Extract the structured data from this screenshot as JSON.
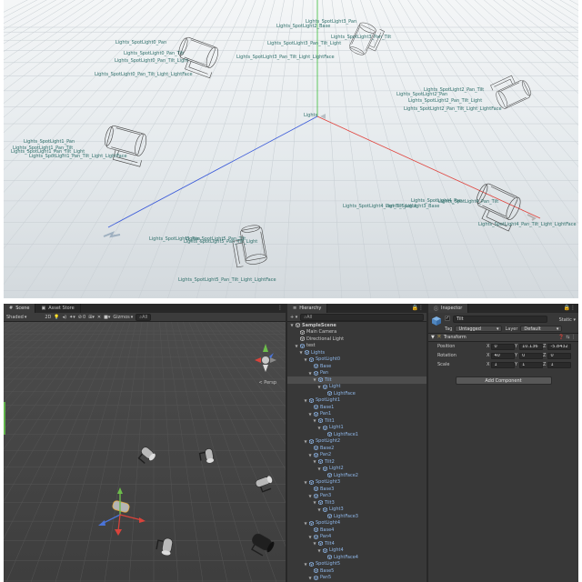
{
  "top_view": {
    "labels": [
      "Lights_SpotLight0_Pan",
      "Lights_SpotLight0_Pan_Tilt",
      "Lights_SpotLight0_Pan_Tilt_Light",
      "Lights_SpotLight0_Pan_Tilt_Light_LightFace",
      "Lights_SpotLight1_Pan",
      "Lights_SpotLight1_Pan_Tilt",
      "Lights_SpotLight1_Pan_Tilt_Light",
      "Lights_SpotLight1_Pan_Tilt_Light_LightFace",
      "Lights_SpotLight2_Pan",
      "Lights_SpotLight2_Pan_Tilt",
      "Lights_SpotLight2_Pan_Tilt_Light",
      "Lights_SpotLight2_Pan_Tilt_Light_LightFace",
      "Lights_SpotLight3_Pan",
      "Lights_SpotLight3_Pan_Tilt",
      "Lights_SpotLight3_Pan_Tilt_Light",
      "Lights_SpotLight3_Pan_Tilt_Light_LightFace",
      "Lights_SpotLight4_Pan",
      "Lights_SpotLight4_Pan_Tilt",
      "Lights_SpotLight4_Pan_Tilt_Light",
      "Lights_SpotLight4_Pan_Tilt_Light_LightFace",
      "Lights_SpotLight5_Pan",
      "Lights_SpotLight5_Pan_Tilt",
      "Lights_SpotLight5_Pan_Tilt_Light",
      "Lights_SpotLight5_Pan_Tilt_Light_LightFace",
      "Lights",
      "Lights_SpotLight3_Base",
      "Lights_SpotLight2_Base"
    ],
    "axis_colors": {
      "x": "#e0403a",
      "y": "#3bbd3b",
      "z": "#3b5bd9"
    }
  },
  "scene_panel": {
    "tabs": [
      "Scene",
      "Asset Store"
    ],
    "more_glyph": "⋮",
    "toolbar": {
      "shading": "Shaded",
      "mode_2d": "2D",
      "gizmos": "Gizmos",
      "search_placeholder": "All",
      "count_badge": "0"
    },
    "persp_label": "< Persp"
  },
  "hierarchy": {
    "tab": "Hierarchy",
    "add_label": "+ ▾",
    "search_placeholder": "All",
    "tree": [
      {
        "label": "SampleScene",
        "depth": 0,
        "arrow": "▼",
        "kind": "scene"
      },
      {
        "label": "Main Camera",
        "depth": 1,
        "arrow": "",
        "kind": "obj"
      },
      {
        "label": "Directional Light",
        "depth": 1,
        "arrow": "",
        "kind": "obj"
      },
      {
        "label": "test",
        "depth": 1,
        "arrow": "▼",
        "kind": "prefab"
      },
      {
        "label": "Lights",
        "depth": 2,
        "arrow": "▼",
        "kind": "blue"
      },
      {
        "label": "SpotLight0",
        "depth": 3,
        "arrow": "▼",
        "kind": "blue"
      },
      {
        "label": "Base",
        "depth": 4,
        "arrow": "",
        "kind": "blue"
      },
      {
        "label": "Pan",
        "depth": 4,
        "arrow": "▼",
        "kind": "blue"
      },
      {
        "label": "Tilt",
        "depth": 5,
        "arrow": "▼",
        "kind": "blue",
        "selected": true
      },
      {
        "label": "Light",
        "depth": 6,
        "arrow": "▼",
        "kind": "blue"
      },
      {
        "label": "LightFace",
        "depth": 7,
        "arrow": "",
        "kind": "blue"
      },
      {
        "label": "SpotLight1",
        "depth": 3,
        "arrow": "▼",
        "kind": "blue"
      },
      {
        "label": "Base1",
        "depth": 4,
        "arrow": "",
        "kind": "blue"
      },
      {
        "label": "Pan1",
        "depth": 4,
        "arrow": "▼",
        "kind": "blue"
      },
      {
        "label": "Tilt1",
        "depth": 5,
        "arrow": "▼",
        "kind": "blue"
      },
      {
        "label": "Light1",
        "depth": 6,
        "arrow": "▼",
        "kind": "blue"
      },
      {
        "label": "LightFace1",
        "depth": 7,
        "arrow": "",
        "kind": "blue"
      },
      {
        "label": "SpotLight2",
        "depth": 3,
        "arrow": "▼",
        "kind": "blue"
      },
      {
        "label": "Base2",
        "depth": 4,
        "arrow": "",
        "kind": "blue"
      },
      {
        "label": "Pan2",
        "depth": 4,
        "arrow": "▼",
        "kind": "blue"
      },
      {
        "label": "Tilt2",
        "depth": 5,
        "arrow": "▼",
        "kind": "blue"
      },
      {
        "label": "Light2",
        "depth": 6,
        "arrow": "▼",
        "kind": "blue"
      },
      {
        "label": "LightFace2",
        "depth": 7,
        "arrow": "",
        "kind": "blue"
      },
      {
        "label": "SpotLight3",
        "depth": 3,
        "arrow": "▼",
        "kind": "blue"
      },
      {
        "label": "Base3",
        "depth": 4,
        "arrow": "",
        "kind": "blue"
      },
      {
        "label": "Pan3",
        "depth": 4,
        "arrow": "▼",
        "kind": "blue"
      },
      {
        "label": "Tilt3",
        "depth": 5,
        "arrow": "▼",
        "kind": "blue"
      },
      {
        "label": "Light3",
        "depth": 6,
        "arrow": "▼",
        "kind": "blue"
      },
      {
        "label": "LightFace3",
        "depth": 7,
        "arrow": "",
        "kind": "blue"
      },
      {
        "label": "SpotLight4",
        "depth": 3,
        "arrow": "▼",
        "kind": "blue"
      },
      {
        "label": "Base4",
        "depth": 4,
        "arrow": "",
        "kind": "blue"
      },
      {
        "label": "Pan4",
        "depth": 4,
        "arrow": "▼",
        "kind": "blue"
      },
      {
        "label": "Tilt4",
        "depth": 5,
        "arrow": "▼",
        "kind": "blue"
      },
      {
        "label": "Light4",
        "depth": 6,
        "arrow": "▼",
        "kind": "blue"
      },
      {
        "label": "LightFace4",
        "depth": 7,
        "arrow": "",
        "kind": "blue"
      },
      {
        "label": "SpotLight5",
        "depth": 3,
        "arrow": "▼",
        "kind": "blue"
      },
      {
        "label": "Base5",
        "depth": 4,
        "arrow": "",
        "kind": "blue"
      },
      {
        "label": "Pan5",
        "depth": 4,
        "arrow": "▼",
        "kind": "blue"
      },
      {
        "label": "Tilt5",
        "depth": 5,
        "arrow": "▼",
        "kind": "blue"
      }
    ]
  },
  "inspector": {
    "tab": "Inspector",
    "object_name": "Tilt",
    "static_label": "Static ▾",
    "tag_label": "Tag",
    "tag_value": "Untagged",
    "layer_label": "Layer",
    "layer_value": "Default",
    "transform": {
      "title": "Transform",
      "rows": [
        {
          "name": "Position",
          "x": "0",
          "y": "10.136",
          "z": "-5.8432"
        },
        {
          "name": "Rotation",
          "x": "40",
          "y": "0",
          "z": "0"
        },
        {
          "name": "Scale",
          "x": "1",
          "y": "1",
          "z": "1"
        }
      ]
    },
    "add_component": "Add Component"
  }
}
